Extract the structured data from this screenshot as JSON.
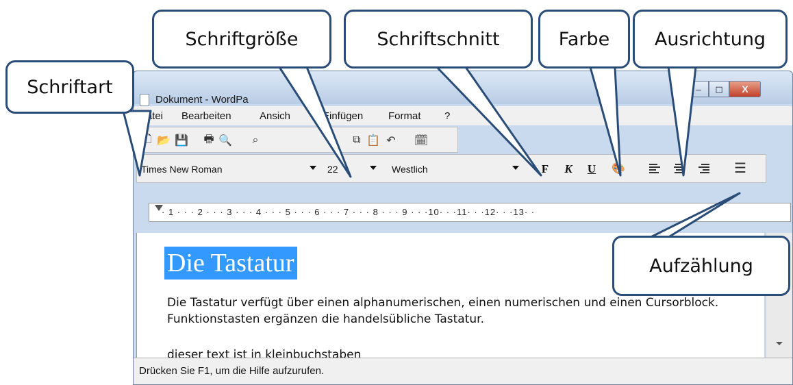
{
  "window": {
    "title": "Dokument - WordPa",
    "buttons": {
      "minimize": "–",
      "maximize": "◻",
      "close": "X"
    }
  },
  "menu": [
    "Datei",
    "Bearbeiten",
    "Ansich",
    "Einfügen",
    "Format",
    "?"
  ],
  "toolbar1": {
    "icons": [
      "new-icon",
      "open-icon",
      "save-icon",
      "print-icon",
      "print-preview-icon",
      "find-icon",
      "copy-icon",
      "paste-icon",
      "undo-icon",
      "insert-datetime-icon"
    ]
  },
  "format_bar": {
    "font": "Times New Roman",
    "size": "22",
    "script": "Westlich",
    "bold": "F",
    "italic": "K",
    "underline": "U"
  },
  "ruler": {
    "marks": "· 1 · · · 2 · · · 3 · · · 4 · · · 5 · · · 6 · · · 7 · · · 8 · · · 9 · · ·10· · ·11· · ·12· · ·13· ·"
  },
  "document": {
    "heading": "Die Tastatur",
    "paragraph": "Die Tastatur verfügt über einen alphanumerischen, einen numerischen und einen Cursorblock. Funktionstasten ergänzen die handelsübliche Tastatur.",
    "line3": "dieser text ist in kleinbuchstaben"
  },
  "status": {
    "text": "Drücken Sie F1, um die Hilfe aufzurufen."
  },
  "callouts": {
    "schriftart": "Schriftart",
    "schriftgroesse": "Schriftgröße",
    "schriftschnitt": "Schriftschnitt",
    "farbe": "Farbe",
    "ausrichtung": "Ausrichtung",
    "aufzaehlung": "Aufzählung"
  },
  "colors": {
    "callout_border": "#2a4d78",
    "selection": "#3399ff",
    "close_button": "#c2402a"
  }
}
